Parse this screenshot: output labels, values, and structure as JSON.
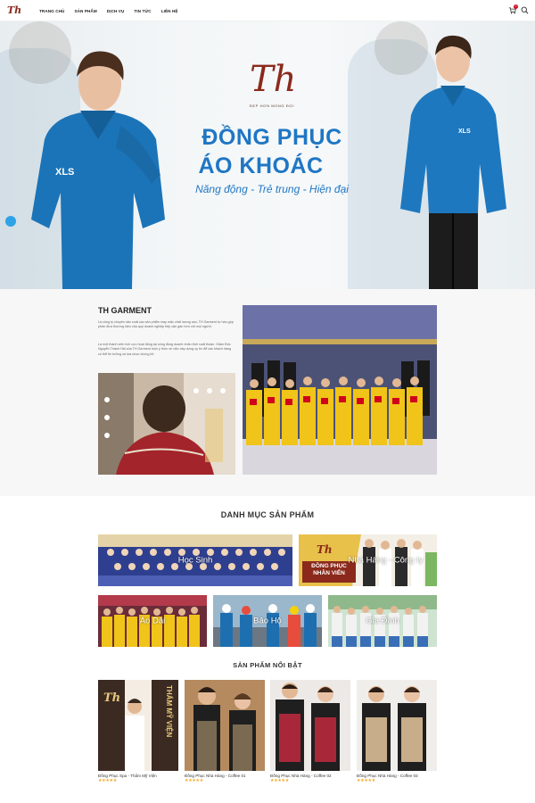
{
  "header": {
    "logo_text": "Th",
    "nav": [
      "TRANG CHỦ",
      "SẢN PHẨM",
      "DỊCH VỤ",
      "TIN TỨC",
      "LIÊN HỆ"
    ],
    "cart_count": "0"
  },
  "hero": {
    "logo_text": "Th",
    "tagline": "ĐẸP HƠN MONG ĐỢI",
    "title_line1": "ĐỒNG PHỤC",
    "title_line2": "ÁO KHOÁC",
    "subtitle": "Năng động - Trẻ trung - Hiện đại"
  },
  "about": {
    "title": "TH GARMENT",
    "para1": "Là công ty chuyên sản xuất các sản phẩm may mặc chất lượng cao, TH Garment tự hào góp phần đưa thương hiệu của quý doanh nghiệp tiếp cận gần hơn với mọi người.",
    "para2": "Là một thành viên tích cực hoạt động tại cộng đồng doanh nhân thời xuất thuần. Giám Đốc Nguyễn Thành Hải của TH Garment luôn ý thức về việc xây dựng uy tín để các khách hàng có thể tin tưởng và lựa chọn chúng tôi."
  },
  "categories": {
    "title": "DANH MỤC SẢN PHẨM",
    "items": [
      "Học Sinh",
      "Nhà Hàng - Công ty",
      "Áo Dài",
      "Bảo Hộ",
      "Gia Đình"
    ],
    "banner_text_line1": "ĐỒNG PHỤC",
    "banner_text_line2": "NHÂN VIÊN"
  },
  "featured": {
    "title": "SẢN PHẨM NỔI BẬT",
    "products": [
      {
        "name": "Đồng Phục Spa - Thẩm Mỹ Viện",
        "stars": "★★★★★"
      },
      {
        "name": "Đồng Phục Nhà Hàng - Coffee 01",
        "stars": "★★★★★"
      },
      {
        "name": "Đồng Phục Nhà Hàng - Coffee 02",
        "stars": "★★★★★"
      },
      {
        "name": "Đồng Phục Nhà Hàng - Coffee 03",
        "stars": "★★★★★"
      }
    ],
    "spa_banner_text": "THẨM MỸ VIỆN"
  },
  "colors": {
    "brand": "#8b2a1c",
    "accent_blue": "#1f76c4",
    "star": "#f5a623"
  },
  "icons": [
    "cart-icon",
    "search-icon"
  ]
}
